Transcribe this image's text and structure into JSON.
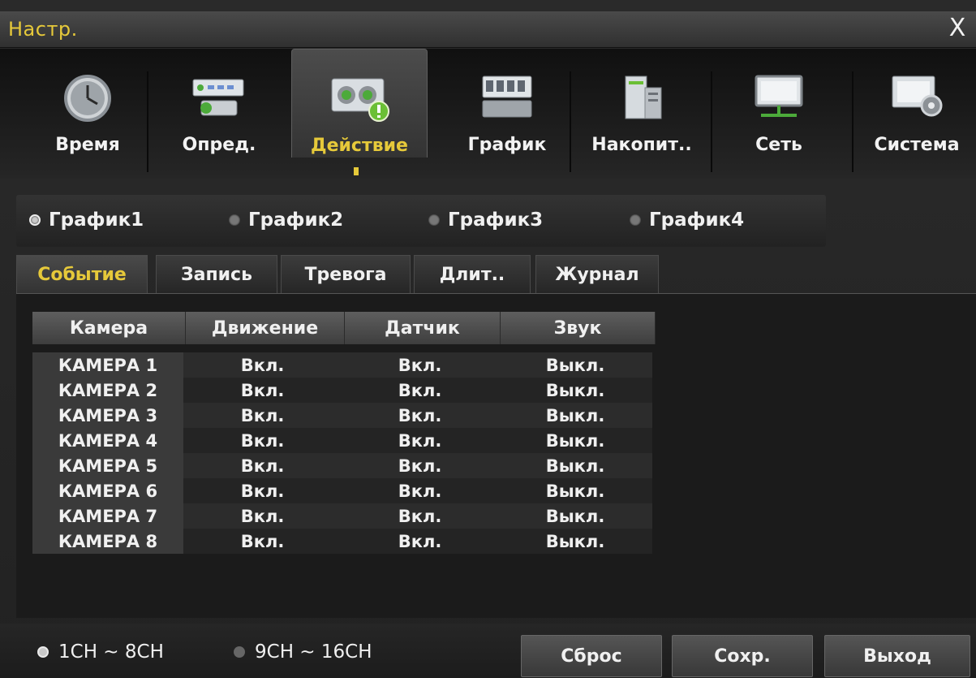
{
  "window": {
    "title": "Настр.",
    "close_label": "X"
  },
  "menu": {
    "items": [
      {
        "label": "Время",
        "icon": "clock-icon"
      },
      {
        "label": "Опред.",
        "icon": "camera-setup-icon"
      },
      {
        "label": "Действие",
        "icon": "action-icon"
      },
      {
        "label": "График",
        "icon": "schedule-icon"
      },
      {
        "label": "Накопит..",
        "icon": "storage-icon"
      },
      {
        "label": "Сеть",
        "icon": "network-icon"
      },
      {
        "label": "Система",
        "icon": "system-icon"
      }
    ],
    "active_index": 2
  },
  "schedules": {
    "options": [
      "График1",
      "График2",
      "График3",
      "График4"
    ],
    "selected_index": 0
  },
  "tabs": {
    "items": [
      "Событие",
      "Запись",
      "Тревога",
      "Длит..",
      "Журнал"
    ],
    "active_index": 0
  },
  "table": {
    "headers": [
      "Камера",
      "Движение",
      "Датчик",
      "Звук"
    ],
    "rows": [
      [
        "КАМЕРА 1",
        "Вкл.",
        "Вкл.",
        "Выкл."
      ],
      [
        "КАМЕРА 2",
        "Вкл.",
        "Вкл.",
        "Выкл."
      ],
      [
        "КАМЕРА 3",
        "Вкл.",
        "Вкл.",
        "Выкл."
      ],
      [
        "КАМЕРА 4",
        "Вкл.",
        "Вкл.",
        "Выкл."
      ],
      [
        "КАМЕРА 5",
        "Вкл.",
        "Вкл.",
        "Выкл."
      ],
      [
        "КАМЕРА 6",
        "Вкл.",
        "Вкл.",
        "Выкл."
      ],
      [
        "КАМЕРА 7",
        "Вкл.",
        "Вкл.",
        "Выкл."
      ],
      [
        "КАМЕРА 8",
        "Вкл.",
        "Вкл.",
        "Выкл."
      ]
    ]
  },
  "channels": {
    "options": [
      "1CH ~ 8CH",
      "9CH ~ 16CH"
    ],
    "selected_index": 0
  },
  "buttons": {
    "reset": "Сброс",
    "save": "Сохр.",
    "exit": "Выход"
  },
  "colors": {
    "accent": "#e6c93a",
    "background": "#222222",
    "header": "#4a4a4a"
  }
}
